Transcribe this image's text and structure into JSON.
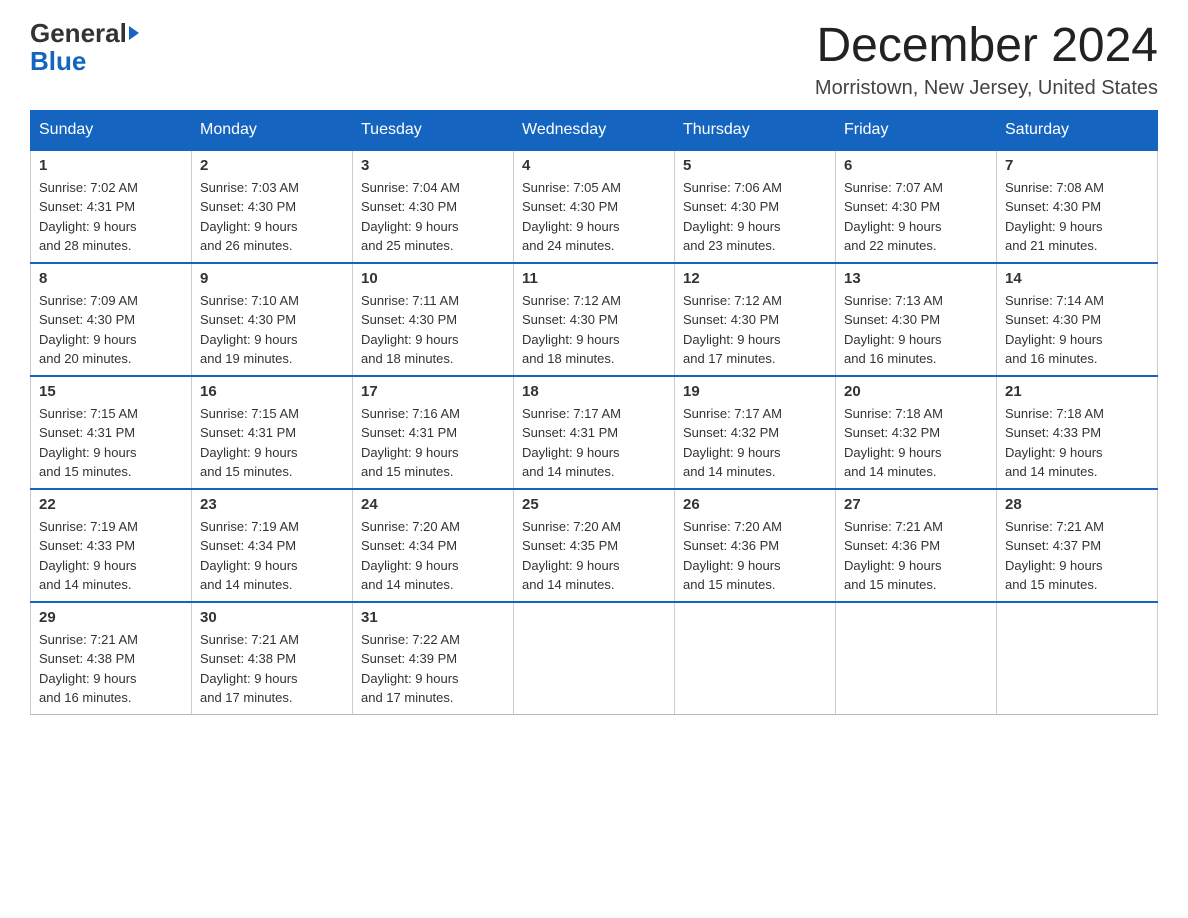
{
  "header": {
    "logo": {
      "part1": "General",
      "part2": "Blue"
    },
    "title": "December 2024",
    "location": "Morristown, New Jersey, United States"
  },
  "days_of_week": [
    "Sunday",
    "Monday",
    "Tuesday",
    "Wednesday",
    "Thursday",
    "Friday",
    "Saturday"
  ],
  "weeks": [
    [
      {
        "day": "1",
        "sunrise": "7:02 AM",
        "sunset": "4:31 PM",
        "daylight": "9 hours and 28 minutes."
      },
      {
        "day": "2",
        "sunrise": "7:03 AM",
        "sunset": "4:30 PM",
        "daylight": "9 hours and 26 minutes."
      },
      {
        "day": "3",
        "sunrise": "7:04 AM",
        "sunset": "4:30 PM",
        "daylight": "9 hours and 25 minutes."
      },
      {
        "day": "4",
        "sunrise": "7:05 AM",
        "sunset": "4:30 PM",
        "daylight": "9 hours and 24 minutes."
      },
      {
        "day": "5",
        "sunrise": "7:06 AM",
        "sunset": "4:30 PM",
        "daylight": "9 hours and 23 minutes."
      },
      {
        "day": "6",
        "sunrise": "7:07 AM",
        "sunset": "4:30 PM",
        "daylight": "9 hours and 22 minutes."
      },
      {
        "day": "7",
        "sunrise": "7:08 AM",
        "sunset": "4:30 PM",
        "daylight": "9 hours and 21 minutes."
      }
    ],
    [
      {
        "day": "8",
        "sunrise": "7:09 AM",
        "sunset": "4:30 PM",
        "daylight": "9 hours and 20 minutes."
      },
      {
        "day": "9",
        "sunrise": "7:10 AM",
        "sunset": "4:30 PM",
        "daylight": "9 hours and 19 minutes."
      },
      {
        "day": "10",
        "sunrise": "7:11 AM",
        "sunset": "4:30 PM",
        "daylight": "9 hours and 18 minutes."
      },
      {
        "day": "11",
        "sunrise": "7:12 AM",
        "sunset": "4:30 PM",
        "daylight": "9 hours and 18 minutes."
      },
      {
        "day": "12",
        "sunrise": "7:12 AM",
        "sunset": "4:30 PM",
        "daylight": "9 hours and 17 minutes."
      },
      {
        "day": "13",
        "sunrise": "7:13 AM",
        "sunset": "4:30 PM",
        "daylight": "9 hours and 16 minutes."
      },
      {
        "day": "14",
        "sunrise": "7:14 AM",
        "sunset": "4:30 PM",
        "daylight": "9 hours and 16 minutes."
      }
    ],
    [
      {
        "day": "15",
        "sunrise": "7:15 AM",
        "sunset": "4:31 PM",
        "daylight": "9 hours and 15 minutes."
      },
      {
        "day": "16",
        "sunrise": "7:15 AM",
        "sunset": "4:31 PM",
        "daylight": "9 hours and 15 minutes."
      },
      {
        "day": "17",
        "sunrise": "7:16 AM",
        "sunset": "4:31 PM",
        "daylight": "9 hours and 15 minutes."
      },
      {
        "day": "18",
        "sunrise": "7:17 AM",
        "sunset": "4:31 PM",
        "daylight": "9 hours and 14 minutes."
      },
      {
        "day": "19",
        "sunrise": "7:17 AM",
        "sunset": "4:32 PM",
        "daylight": "9 hours and 14 minutes."
      },
      {
        "day": "20",
        "sunrise": "7:18 AM",
        "sunset": "4:32 PM",
        "daylight": "9 hours and 14 minutes."
      },
      {
        "day": "21",
        "sunrise": "7:18 AM",
        "sunset": "4:33 PM",
        "daylight": "9 hours and 14 minutes."
      }
    ],
    [
      {
        "day": "22",
        "sunrise": "7:19 AM",
        "sunset": "4:33 PM",
        "daylight": "9 hours and 14 minutes."
      },
      {
        "day": "23",
        "sunrise": "7:19 AM",
        "sunset": "4:34 PM",
        "daylight": "9 hours and 14 minutes."
      },
      {
        "day": "24",
        "sunrise": "7:20 AM",
        "sunset": "4:34 PM",
        "daylight": "9 hours and 14 minutes."
      },
      {
        "day": "25",
        "sunrise": "7:20 AM",
        "sunset": "4:35 PM",
        "daylight": "9 hours and 14 minutes."
      },
      {
        "day": "26",
        "sunrise": "7:20 AM",
        "sunset": "4:36 PM",
        "daylight": "9 hours and 15 minutes."
      },
      {
        "day": "27",
        "sunrise": "7:21 AM",
        "sunset": "4:36 PM",
        "daylight": "9 hours and 15 minutes."
      },
      {
        "day": "28",
        "sunrise": "7:21 AM",
        "sunset": "4:37 PM",
        "daylight": "9 hours and 15 minutes."
      }
    ],
    [
      {
        "day": "29",
        "sunrise": "7:21 AM",
        "sunset": "4:38 PM",
        "daylight": "9 hours and 16 minutes."
      },
      {
        "day": "30",
        "sunrise": "7:21 AM",
        "sunset": "4:38 PM",
        "daylight": "9 hours and 17 minutes."
      },
      {
        "day": "31",
        "sunrise": "7:22 AM",
        "sunset": "4:39 PM",
        "daylight": "9 hours and 17 minutes."
      },
      null,
      null,
      null,
      null
    ]
  ],
  "labels": {
    "sunrise_prefix": "Sunrise: ",
    "sunset_prefix": "Sunset: ",
    "daylight_prefix": "Daylight: "
  }
}
